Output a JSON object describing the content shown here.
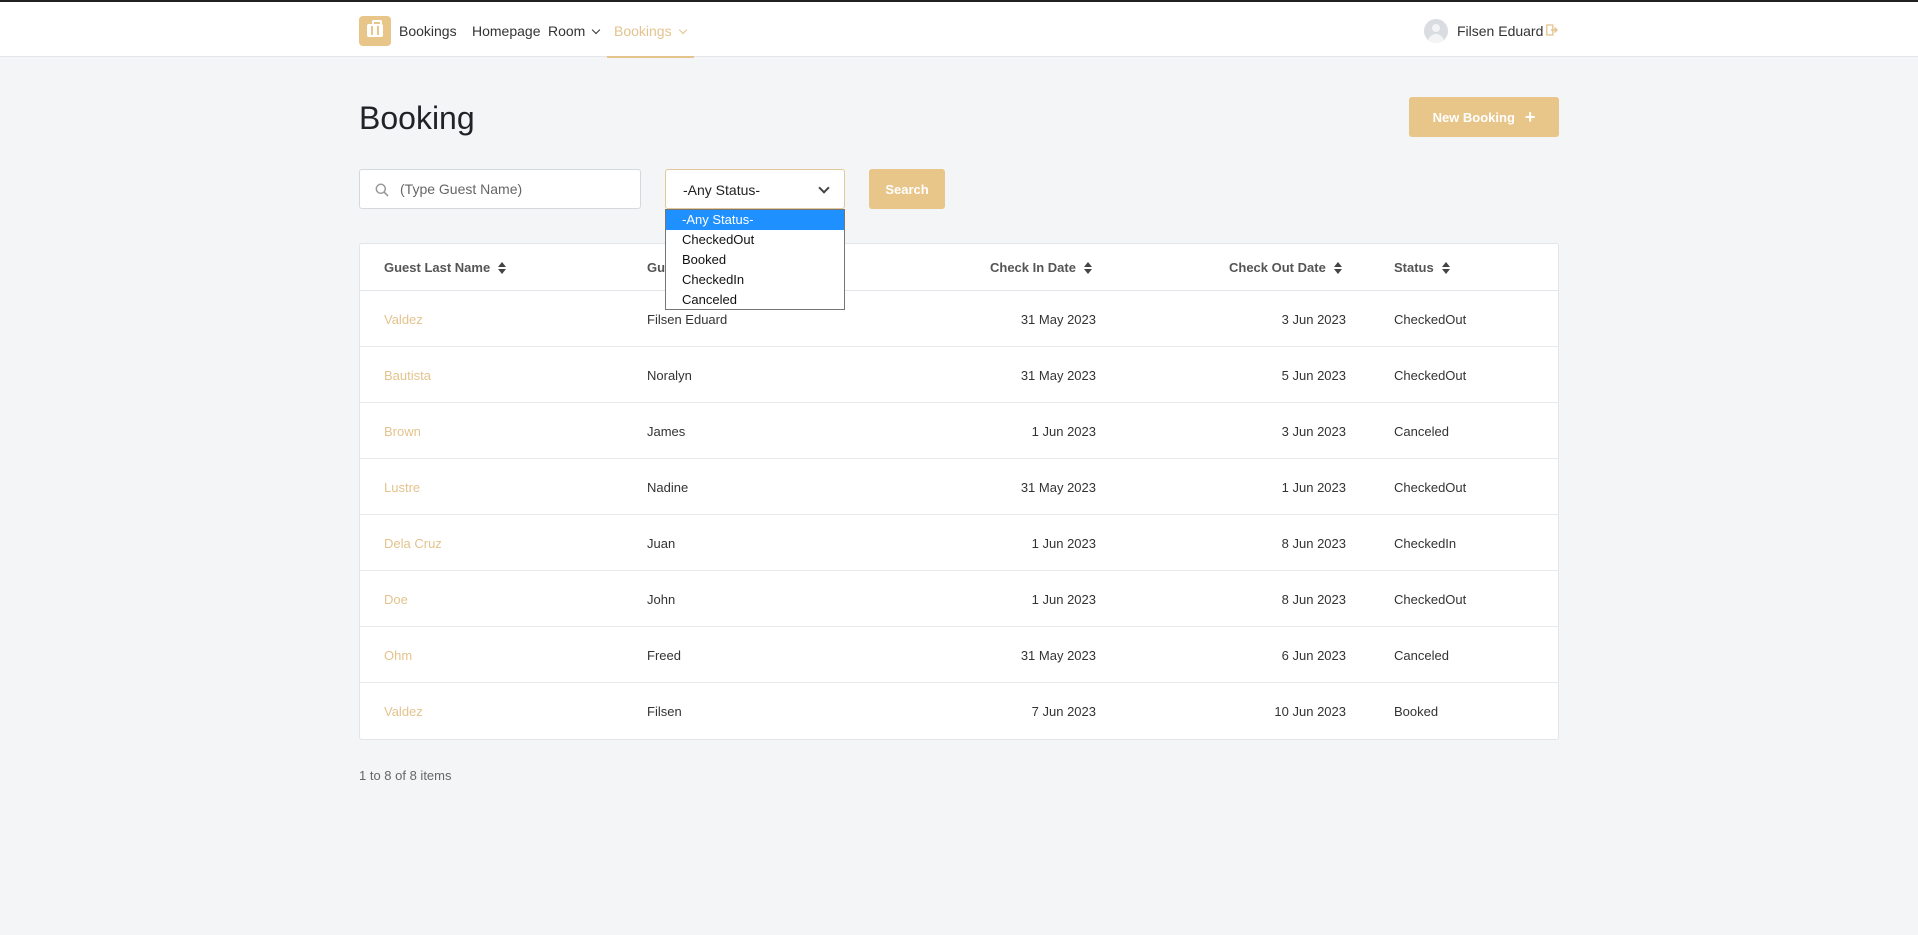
{
  "nav": {
    "brand": "Bookings",
    "homepage": "Homepage",
    "room": "Room",
    "bookings": "Bookings",
    "user_name": "Filsen Eduard"
  },
  "page": {
    "title": "Booking",
    "new_booking_label": "New Booking",
    "search_placeholder": "(Type Guest Name)",
    "status_value": "-Any Status-",
    "search_label": "Search",
    "pagination_text": "1 to 8 of 8 items"
  },
  "status_options": [
    "-Any Status-",
    "CheckedOut",
    "Booked",
    "CheckedIn",
    "Canceled"
  ],
  "table": {
    "columns": [
      "Guest Last Name",
      "Gu",
      "Check In Date",
      "Check Out Date",
      "Status"
    ],
    "rows": [
      {
        "last": "Valdez",
        "first": "Filsen Eduard",
        "checkin": "31 May 2023",
        "checkout": "3 Jun 2023",
        "status": "CheckedOut"
      },
      {
        "last": "Bautista",
        "first": "Noralyn",
        "checkin": "31 May 2023",
        "checkout": "5 Jun 2023",
        "status": "CheckedOut"
      },
      {
        "last": "Brown",
        "first": "James",
        "checkin": "1 Jun 2023",
        "checkout": "3 Jun 2023",
        "status": "Canceled"
      },
      {
        "last": "Lustre",
        "first": "Nadine",
        "checkin": "31 May 2023",
        "checkout": "1 Jun 2023",
        "status": "CheckedOut"
      },
      {
        "last": "Dela Cruz",
        "first": "Juan",
        "checkin": "1 Jun 2023",
        "checkout": "8 Jun 2023",
        "status": "CheckedIn"
      },
      {
        "last": "Doe",
        "first": "John",
        "checkin": "1 Jun 2023",
        "checkout": "8 Jun 2023",
        "status": "CheckedOut"
      },
      {
        "last": "Ohm",
        "first": "Freed",
        "checkin": "31 May 2023",
        "checkout": "6 Jun 2023",
        "status": "Canceled"
      },
      {
        "last": "Valdez",
        "first": "Filsen",
        "checkin": "7 Jun 2023",
        "checkout": "10 Jun 2023",
        "status": "Booked"
      }
    ]
  },
  "colors": {
    "accent": "#e8c588",
    "link": "#e4c38d",
    "selected_option": "#1e90ff"
  }
}
